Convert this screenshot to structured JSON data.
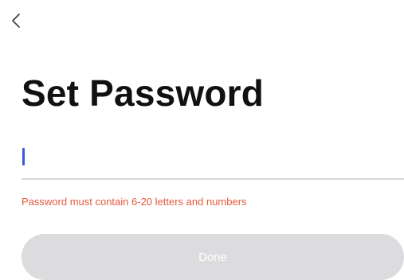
{
  "header": {
    "back_icon": "chevron-left-icon"
  },
  "page": {
    "title": "Set Password"
  },
  "password": {
    "value": "",
    "placeholder": ""
  },
  "validation": {
    "message": "Password must contain 6-20 letters and numbers",
    "color": "#e35a3f"
  },
  "actions": {
    "done_label": "Done",
    "done_state": "disabled"
  },
  "colors": {
    "caret": "#3a5bd9",
    "button_disabled_bg": "#dcdcde"
  }
}
